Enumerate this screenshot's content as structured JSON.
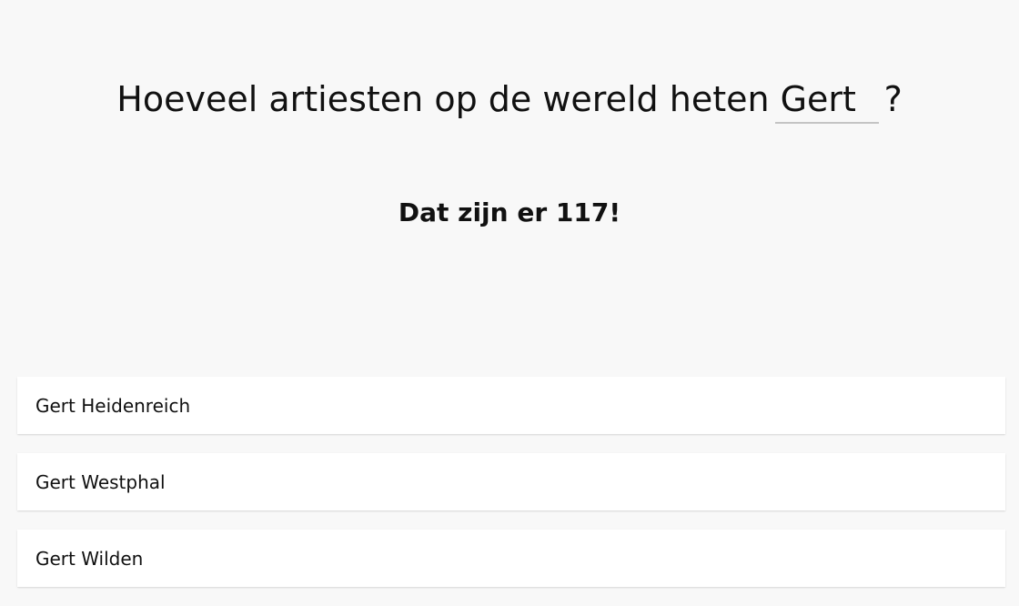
{
  "question": {
    "prefix": "Hoeveel artiesten op de wereld heten",
    "name_value": "Gert",
    "suffix": "?"
  },
  "answer": {
    "text": "Dat zijn er 117!"
  },
  "results": [
    "Gert Heidenreich",
    "Gert Westphal",
    "Gert Wilden"
  ]
}
